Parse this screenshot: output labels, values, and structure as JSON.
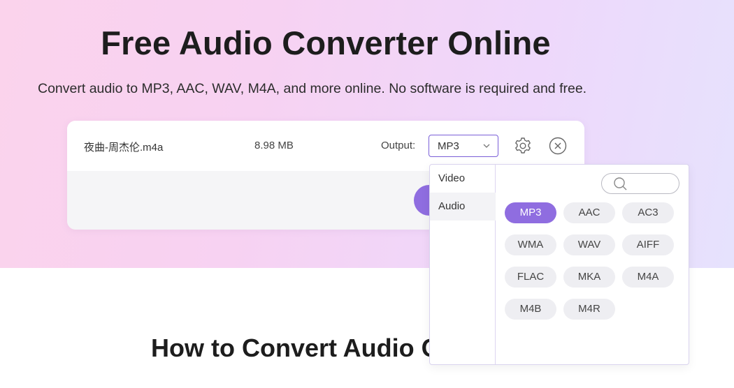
{
  "hero": {
    "title": "Free Audio Converter Online",
    "subtitle": "Convert audio to MP3, AAC, WAV, M4A, and more online. No software is required and free."
  },
  "file": {
    "name": "夜曲-周杰伦.m4a",
    "size": "8.98 MB",
    "output_label": "Output:",
    "selected_format": "MP3"
  },
  "dropdown": {
    "categories": [
      "Video",
      "Audio"
    ],
    "active_category": "Audio",
    "formats": [
      "MP3",
      "AAC",
      "AC3",
      "WMA",
      "WAV",
      "AIFF",
      "FLAC",
      "MKA",
      "M4A",
      "M4B",
      "M4R"
    ],
    "selected": "MP3"
  },
  "section": {
    "title": "How to Convert Audio O"
  },
  "colors": {
    "accent": "#8f6de0",
    "chip_bg": "#eeeef2"
  },
  "icons": {
    "settings": "gear-icon",
    "remove": "close-circle-icon",
    "dropdown": "chevron-down-icon",
    "search": "search-icon"
  }
}
